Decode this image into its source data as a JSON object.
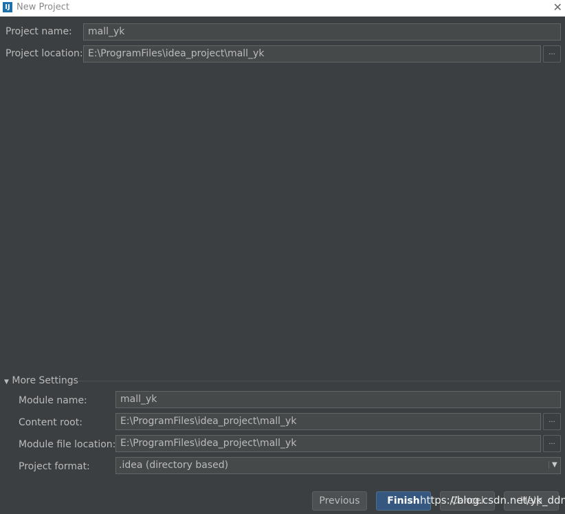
{
  "window": {
    "title": "New Project",
    "close_icon": "close-icon",
    "logo_text": "IJ"
  },
  "project": {
    "name_label": "Project name:",
    "name_value": "mall_yk",
    "location_label": "Project location:",
    "location_value": "E:\\ProgramFiles\\idea_project\\mall_yk",
    "browse": "..."
  },
  "more_settings": {
    "label": "More Settings",
    "module_name_label": "Module name:",
    "module_name_value": "mall_yk",
    "content_root_label": "Content root:",
    "content_root_value": "E:\\ProgramFiles\\idea_project\\mall_yk",
    "module_file_label": "Module file location:",
    "module_file_value": "E:\\ProgramFiles\\idea_project\\mall_yk",
    "format_label": "Project format:",
    "format_value": ".idea (directory based)"
  },
  "buttons": {
    "previous": "Previous",
    "finish": "Finish",
    "cancel": "Cancel",
    "help": "Help"
  },
  "watermark": "https://blog.csdn.net/yk_ddm"
}
